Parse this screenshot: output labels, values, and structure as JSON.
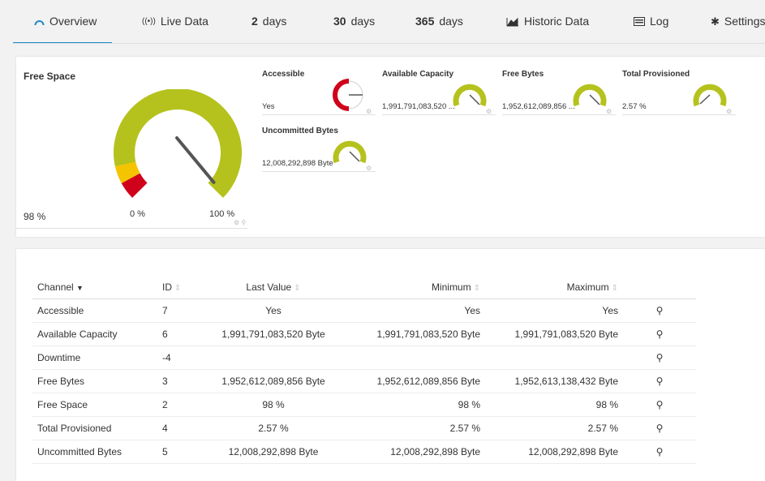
{
  "tabs": [
    {
      "label": "Overview",
      "icon": "overview-gauge-icon",
      "active": true
    },
    {
      "label": "Live Data",
      "icon": "live-signal-icon"
    },
    {
      "label_num": "2",
      "label_unit": "days"
    },
    {
      "label_num": "30",
      "label_unit": "days"
    },
    {
      "label_num": "365",
      "label_unit": "days"
    },
    {
      "label": "Historic Data",
      "icon": "area-chart-icon"
    },
    {
      "label": "Log",
      "icon": "log-list-icon"
    },
    {
      "label": "Settings",
      "icon": "gear-icon"
    }
  ],
  "main_gauge": {
    "title": "Free Space",
    "value_text": "98 %",
    "value_pct": 98,
    "min_label": "0 %",
    "max_label": "100 %"
  },
  "mini_gauges": [
    {
      "title": "Accessible",
      "value": "Yes",
      "color": "#d0021b"
    },
    {
      "title": "Available Capacity",
      "value": "1,991,791,083,520 ...",
      "color": "#b5c21d"
    },
    {
      "title": "Free Bytes",
      "value": "1,952,612,089,856 ...",
      "color": "#b5c21d"
    },
    {
      "title": "Total Provisioned",
      "value": "2.57 %",
      "color": "#b5c21d"
    },
    {
      "title": "Uncommitted Bytes",
      "value": "12,008,292,898 Byte",
      "color": "#b5c21d"
    }
  ],
  "table": {
    "headers": [
      "Channel",
      "ID",
      "Last Value",
      "Minimum",
      "Maximum"
    ],
    "rows": [
      {
        "channel": "Accessible",
        "id": "7",
        "last": "Yes",
        "min": "Yes",
        "max": "Yes"
      },
      {
        "channel": "Available Capacity",
        "id": "6",
        "last": "1,991,791,083,520 Byte",
        "min": "1,991,791,083,520 Byte",
        "max": "1,991,791,083,520 Byte"
      },
      {
        "channel": "Downtime",
        "id": "-4",
        "last": "",
        "min": "",
        "max": ""
      },
      {
        "channel": "Free Bytes",
        "id": "3",
        "last": "1,952,612,089,856 Byte",
        "min": "1,952,612,089,856 Byte",
        "max": "1,952,613,138,432 Byte"
      },
      {
        "channel": "Free Space",
        "id": "2",
        "last": "98 %",
        "min": "98 %",
        "max": "98 %"
      },
      {
        "channel": "Total Provisioned",
        "id": "4",
        "last": "2.57 %",
        "min": "2.57 %",
        "max": "2.57 %"
      },
      {
        "channel": "Uncommitted Bytes",
        "id": "5",
        "last": "12,008,292,898 Byte",
        "min": "12,008,292,898 Byte",
        "max": "12,008,292,898 Byte"
      }
    ]
  },
  "colors": {
    "accent": "#1e88c7",
    "gauge_green": "#b5c21d",
    "gauge_yellow": "#f5c400",
    "gauge_red": "#d0021b"
  }
}
